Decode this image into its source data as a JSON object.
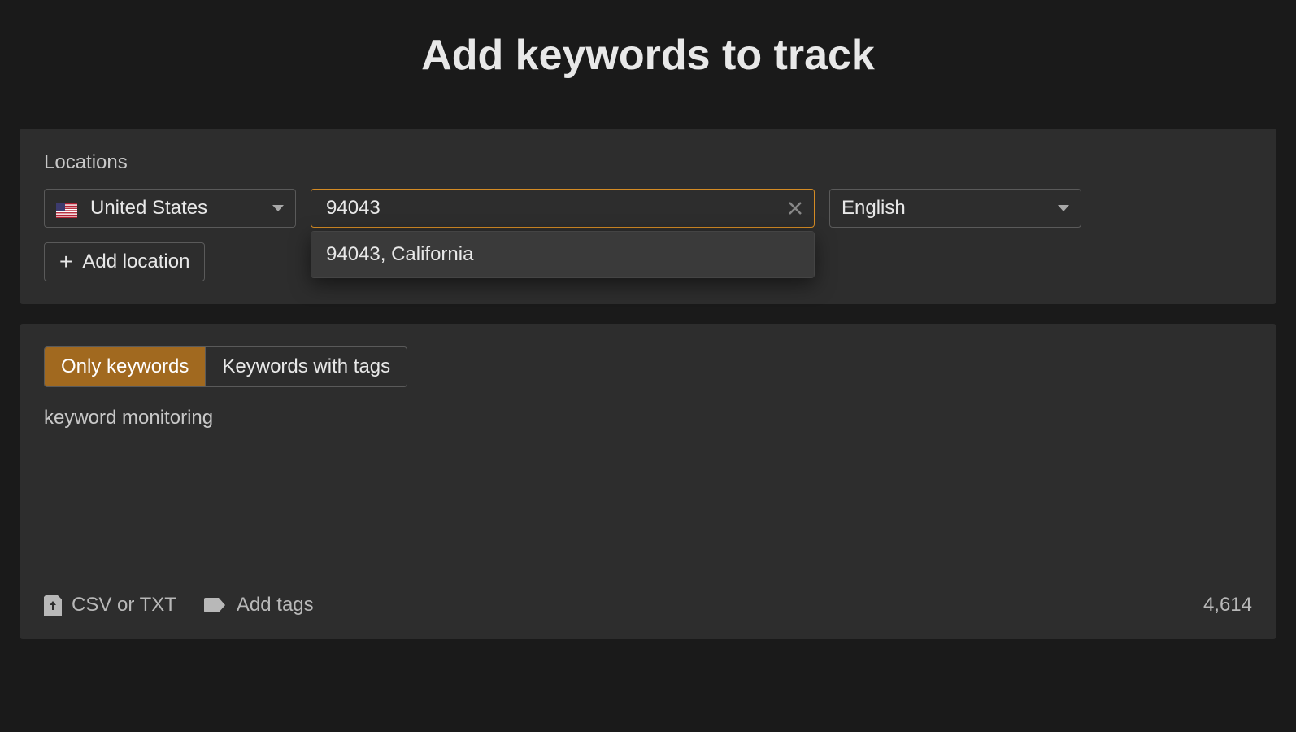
{
  "header": {
    "title": "Add keywords to track"
  },
  "locations": {
    "label": "Locations",
    "country_selected": "United States",
    "language_selected": "English",
    "search_value": "94043",
    "suggestion": "94043, California",
    "add_location_label": "Add location"
  },
  "keywords_panel": {
    "tabs": [
      {
        "label": "Only keywords",
        "active": true
      },
      {
        "label": "Keywords with tags",
        "active": false
      }
    ],
    "content": "keyword monitoring",
    "upload_label": "CSV or TXT",
    "add_tags_label": "Add tags",
    "count": "4,614"
  }
}
